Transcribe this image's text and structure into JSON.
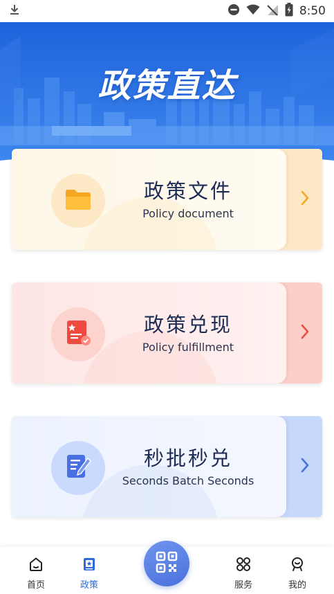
{
  "status_bar": {
    "time": "8:50",
    "icons": [
      "download-icon",
      "dnd-icon",
      "wifi-icon",
      "no-signal-icon",
      "battery-charging-icon"
    ]
  },
  "banner": {
    "title": "政策直达"
  },
  "cards": [
    {
      "title": "政策文件",
      "subtitle": "Policy document",
      "icon": "folder-icon",
      "accent": "#f5a623"
    },
    {
      "title": "政策兑现",
      "subtitle": "Policy fulfillment",
      "icon": "document-check-icon",
      "accent": "#ee4a3f"
    },
    {
      "title": "秒批秒兑",
      "subtitle": "Seconds Batch Seconds",
      "icon": "edit-note-icon",
      "accent": "#4a6fe0"
    }
  ],
  "tab_bar": {
    "items": [
      {
        "label": "首页",
        "icon": "home-icon",
        "active": false
      },
      {
        "label": "政策",
        "icon": "policy-book-icon",
        "active": true
      },
      {
        "label": "服务",
        "icon": "grid-icon",
        "active": false
      },
      {
        "label": "我的",
        "icon": "profile-icon",
        "active": false
      }
    ],
    "center_icon": "qr-scan-icon"
  },
  "colors": {
    "banner_blue": "#2e6fe0",
    "active_tab": "#2f6bd8"
  }
}
